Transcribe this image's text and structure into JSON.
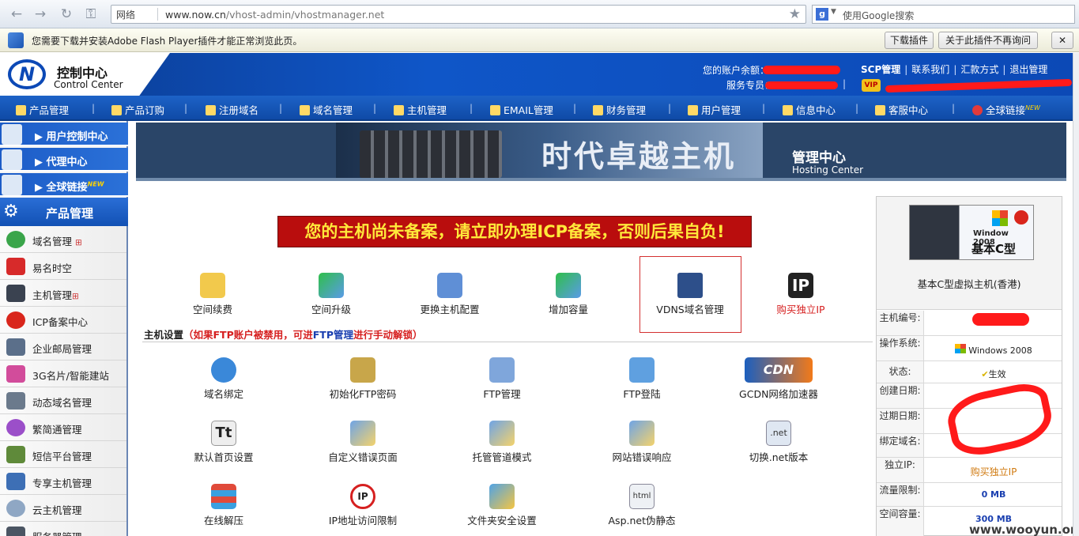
{
  "browser": {
    "security_label": "网络",
    "url_host": "www.now.cn",
    "url_path": "/vhost-admin/vhostmanager.net",
    "search_placeholder": "使用Google搜索"
  },
  "plugin_bar": {
    "message": "您需要下载并安装Adobe Flash Player插件才能正常浏览此页。",
    "download_label": "下载插件",
    "dismiss_label": "关于此插件不再询问"
  },
  "header": {
    "title_cn": "控制中心",
    "title_en": "Control Center",
    "balance_label": "您的账户余额：",
    "service_label": "服务专员：",
    "links": [
      "SCP管理",
      "联系我们",
      "汇款方式",
      "退出管理"
    ]
  },
  "topnav": [
    "产品管理",
    "产品订购",
    "注册域名",
    "域名管理",
    "主机管理",
    "EMAIL管理",
    "财务管理",
    "用户管理",
    "信息中心",
    "客服中心",
    "全球链接"
  ],
  "sidebar": {
    "top": [
      "用户控制中心",
      "代理中心",
      "全球链接"
    ],
    "product_title": "产品管理",
    "items": [
      "域名管理",
      "易名时空",
      "主机管理",
      "ICP备案中心",
      "企业邮局管理",
      "3G名片/智能建站",
      "动态域名管理",
      "繁简通管理",
      "短信平台管理",
      "专享主机管理",
      "云主机管理",
      "服务器管理"
    ]
  },
  "banner": {
    "headline": "时代卓越主机",
    "subtitle_cn": "管理中心",
    "subtitle_en": "Hosting Center"
  },
  "warning": "您的主机尚未备案，请立即办理ICP备案，否则后果自负!",
  "actions_row1": [
    "空间续费",
    "空间升级",
    "更换主机配置",
    "增加容量",
    "VDNS域名管理",
    "购买独立IP"
  ],
  "section": {
    "title": "主机设置",
    "note_prefix": "（如果FTP账户被禁用，可进",
    "note_link": "FTP管理",
    "note_suffix": "进行手动解锁）"
  },
  "settings": [
    "域名绑定",
    "初始化FTP密码",
    "FTP管理",
    "FTP登陆",
    "GCDN网络加速器",
    "默认首页设置",
    "自定义错误页面",
    "托管管道模式",
    "网站错误响应",
    "切换.net版本",
    "在线解压",
    "IP地址访问限制",
    "文件夹安全设置",
    "Asp.net伪静态"
  ],
  "right_panel": {
    "badge_os": "Window 2008",
    "badge_type": "基本C型",
    "product_name": "基本C型虚拟主机(香港)",
    "rows": [
      {
        "k": "主机编号:",
        "v": ""
      },
      {
        "k": "操作系统:",
        "v": "Windows 2008"
      },
      {
        "k": "状态:",
        "v": "生效"
      },
      {
        "k": "创建日期:",
        "v": ""
      },
      {
        "k": "过期日期:",
        "v": ""
      },
      {
        "k": "绑定域名:",
        "v": ""
      },
      {
        "k": "独立IP:",
        "v": "购买独立IP"
      },
      {
        "k": "流量限制:",
        "v": "0 MB"
      },
      {
        "k": "空间容量:",
        "v": "300 MB"
      }
    ]
  },
  "watermark": "www.wooyun.org",
  "colors": {
    "accent_blue": "#0f56c8",
    "warning_red": "#b90d0d",
    "warning_text": "#ffe93b",
    "link_orange": "#d07a10"
  }
}
